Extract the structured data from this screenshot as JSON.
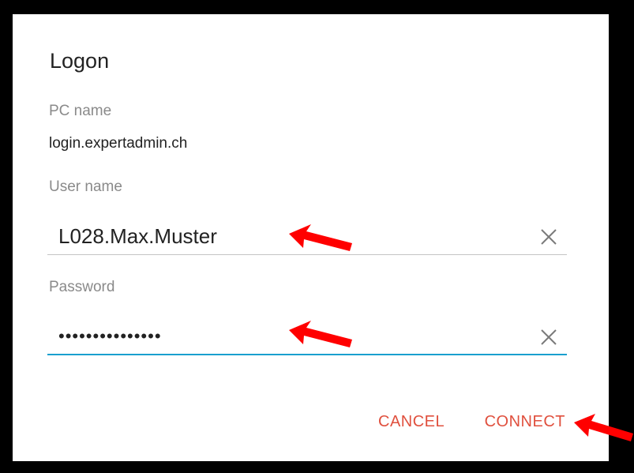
{
  "dialog": {
    "title": "Logon",
    "pc_name_label": "PC name",
    "pc_name_value": "login.expertadmin.ch",
    "username_label": "User name",
    "username_value": "L028.Max.Muster",
    "password_label": "Password",
    "password_value": "•••••••••••••••",
    "cancel_label": "CANCEL",
    "connect_label": "CONNECT"
  },
  "colors": {
    "accent": "#e0503e",
    "focus_underline": "#1a9fcf",
    "annotation_arrow": "#ff0000"
  },
  "icons": {
    "clear": "close-icon",
    "annotation": "arrow-annotation"
  }
}
